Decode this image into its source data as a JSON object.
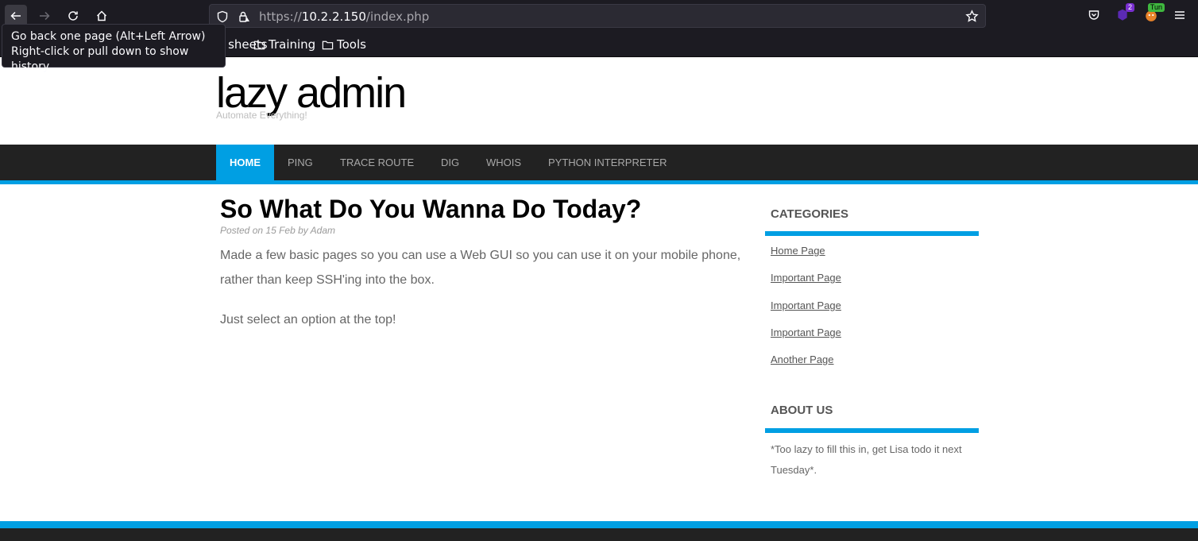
{
  "browser": {
    "url_prefix": "https://",
    "url_host": "10.2.2.150",
    "url_path": "/index.php",
    "ext1_badge": "2",
    "ext2_badge": "Tun",
    "bookmarks": {
      "cheat": "eat sheets",
      "training": "Training",
      "tools": "Tools"
    },
    "tooltip": {
      "line1": "Go back one page (Alt+Left Arrow)",
      "line2": "Right-click or pull down to show history"
    }
  },
  "site": {
    "title": "lazy admin",
    "tagline": "Automate Everything!"
  },
  "nav": {
    "items": [
      "HOME",
      "PING",
      "TRACE ROUTE",
      "DIG",
      "WHOIS",
      "PYTHON INTERPRETER"
    ],
    "active": "HOME"
  },
  "post": {
    "title": "So What Do You Wanna Do Today?",
    "meta_prefix": "Posted on",
    "date": "15 Feb",
    "meta_by": "by",
    "author": "Adam",
    "paragraph1": "Made a few basic pages so you can use a Web GUI so you can use it on your mobile phone, rather than keep SSH'ing into the box.",
    "paragraph2": "Just select an option at the top!"
  },
  "sidebar": {
    "categories_title": "CATEGORIES",
    "links": [
      "Home Page",
      "Important Page",
      "Important Page",
      "Important Page",
      "Another Page"
    ],
    "about_title": "ABOUT US",
    "about_text": "*Too lazy to fill this in, get Lisa todo it next Tuesday*."
  },
  "colors": {
    "accent": "#009fe3",
    "nav_bg": "#222222",
    "chrome_bg": "#1c1b22"
  }
}
